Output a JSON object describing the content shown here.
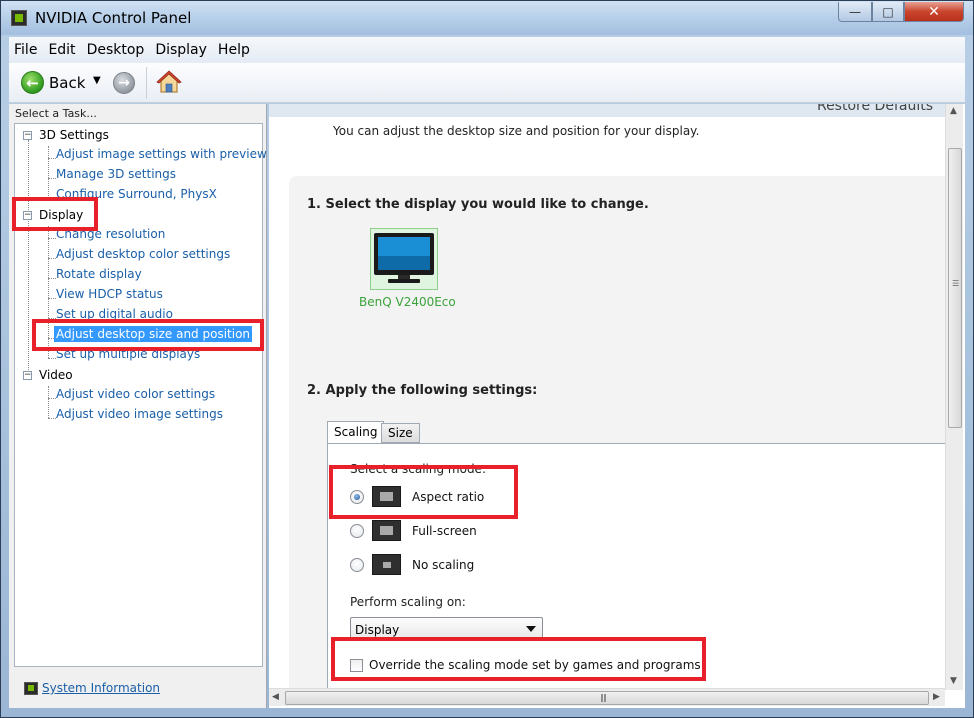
{
  "window": {
    "title": "NVIDIA Control Panel",
    "minimize": "—",
    "maximize": "□",
    "close": "✕"
  },
  "menu": [
    "File",
    "Edit",
    "Desktop",
    "Display",
    "Help"
  ],
  "toolbar": {
    "back_label": "Back",
    "dropdown_glyph": "▼",
    "back_glyph": "←",
    "forward_glyph": "→"
  },
  "sidebar": {
    "heading": "Select a Task...",
    "categories": [
      {
        "label": "3D Settings",
        "expander": "−",
        "items": [
          "Adjust image settings with preview",
          "Manage 3D settings",
          "Configure Surround, PhysX"
        ]
      },
      {
        "label": "Display",
        "expander": "−",
        "items": [
          "Change resolution",
          "Adjust desktop color settings",
          "Rotate display",
          "View HDCP status",
          "Set up digital audio",
          "Adjust desktop size and position",
          "Set up multiple displays"
        ]
      },
      {
        "label": "Video",
        "expander": "−",
        "items": [
          "Adjust video color settings",
          "Adjust video image settings"
        ]
      }
    ],
    "selected_item": "Adjust desktop size and position",
    "system_info": "System Information"
  },
  "content": {
    "restore_defaults": "Restore Defaults",
    "intro": "You can adjust the desktop size and position for your display.",
    "step1": "1. Select the display you would like to change.",
    "display_name": "BenQ V2400Eco",
    "step2": "2. Apply the following settings:",
    "tabs": [
      "Scaling",
      "Size"
    ],
    "active_tab": "Scaling",
    "scaling_mode_label": "Select a scaling mode:",
    "scaling_modes": [
      "Aspect ratio",
      "Full-screen",
      "No scaling"
    ],
    "selected_scaling_mode": "Aspect ratio",
    "perform_scaling_label": "Perform scaling on:",
    "perform_scaling_value": "Display",
    "override_label": "Override the scaling mode set by games and programs",
    "override_checked": false
  },
  "colors": {
    "highlight": "#e8202a",
    "link": "#1a5fa8",
    "selection": "#3399ff",
    "nvidia_green": "#76b900"
  }
}
